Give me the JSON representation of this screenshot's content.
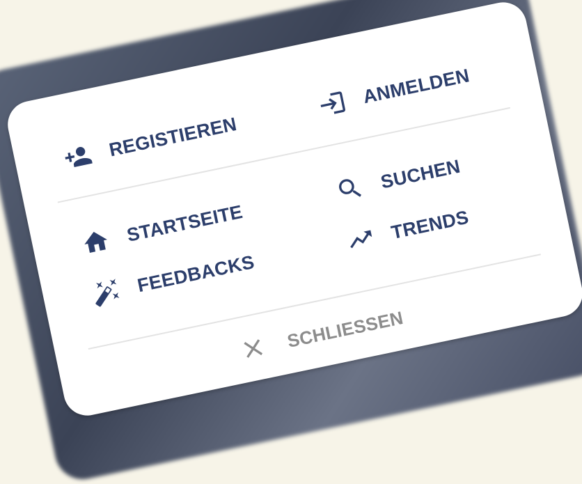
{
  "menu": {
    "account": {
      "register_label": "REGISTIEREN",
      "register_icon": "add-person-icon",
      "login_label": "ANMELDEN",
      "login_icon": "login-icon"
    },
    "navigation": {
      "home_label": "STARTSEITE",
      "home_icon": "home-icon",
      "feedbacks_label": "FEEDBACKS",
      "feedbacks_icon": "magic-wand-icon",
      "search_label": "SUCHEN",
      "search_icon": "search-icon",
      "trends_label": "TRENDS",
      "trends_icon": "trending-up-icon"
    },
    "close": {
      "label": "SCHLIESSEN",
      "icon": "close-icon"
    }
  },
  "colors": {
    "primary_text": "#2c3e6b",
    "muted_text": "#8c8c8c",
    "card_background": "#ffffff",
    "page_background": "#f7f4e8"
  }
}
